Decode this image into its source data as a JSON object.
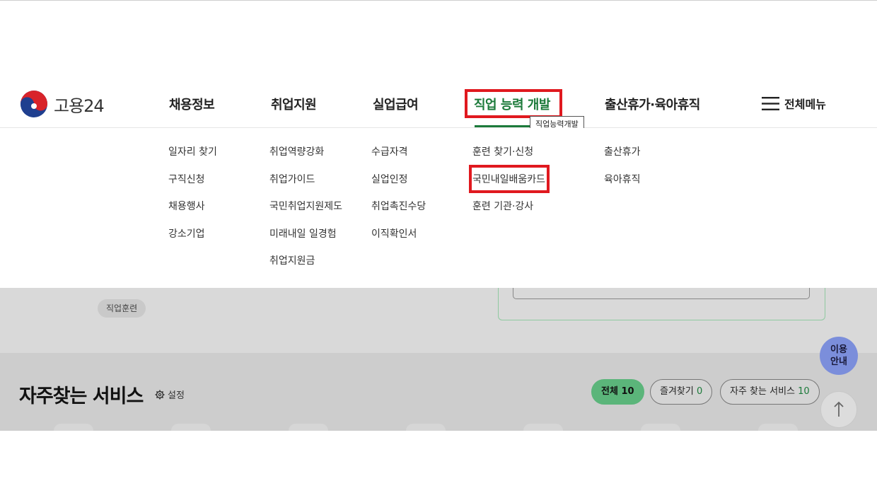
{
  "logo": {
    "text": "고용24",
    "icon": "taegeuk-icon"
  },
  "nav": [
    {
      "label": "채용정보"
    },
    {
      "label": "취업지원"
    },
    {
      "label": "실업급여"
    },
    {
      "label": "직업 능력 개발"
    },
    {
      "label": "출산휴가·육아휴직"
    }
  ],
  "tooltip": "직업능력개발",
  "all_menu": {
    "label": "전체메뉴",
    "icon": "hamburger-icon"
  },
  "submenu": [
    [
      "일자리 찾기",
      "구직신청",
      "채용행사",
      "강소기업"
    ],
    [
      "취업역량강화",
      "취업가이드",
      "국민취업지원제도",
      "미래내일 일경험",
      "취업지원금"
    ],
    [
      "수급자격",
      "실업인정",
      "취업촉진수당",
      "이직확인서"
    ],
    [
      "훈련 찾기·신청",
      "국민내일배움카드",
      "훈련 기관·강사"
    ],
    [
      "출산휴가",
      "육아휴직"
    ]
  ],
  "background": {
    "chip_label": "직업훈련",
    "services_title": "자주찾는 서비스",
    "settings_label": "설정",
    "pills": [
      {
        "label": "전체",
        "count": "10"
      },
      {
        "label": "즐겨찾기",
        "count": "0"
      },
      {
        "label": "자주 찾는 서비스",
        "count": "10"
      }
    ],
    "help_line1": "이용",
    "help_line2": "안내"
  },
  "colors": {
    "accent_green": "#1c7a3a",
    "highlight_red": "#e0191f",
    "help_button": "#7b8edb"
  }
}
